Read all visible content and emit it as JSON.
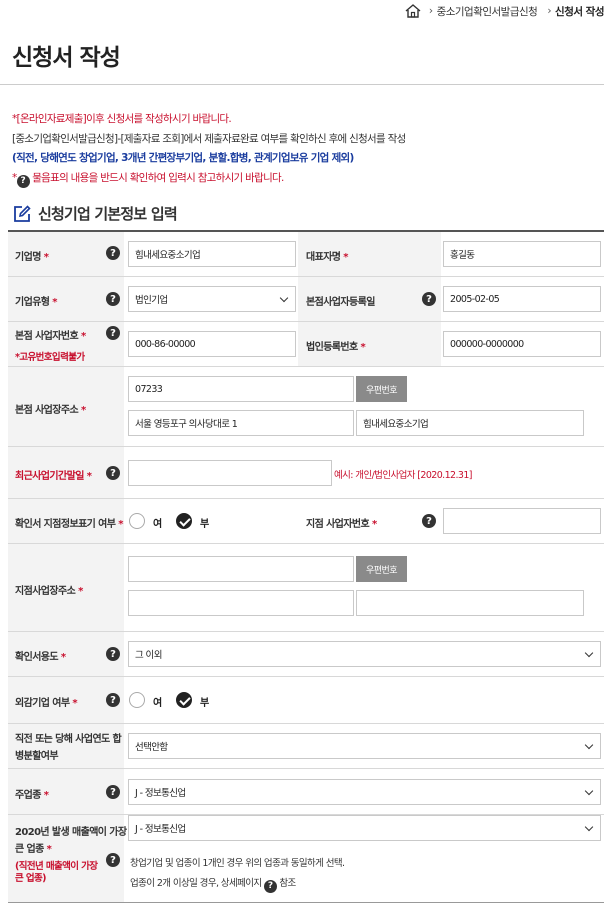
{
  "breadcrumb": {
    "item1": "중소기업확인서발급신청",
    "item2": "신청서 작성"
  },
  "page_title": "신청서 작성",
  "notice": {
    "line1": "*[온라인자료제출]이후 신청서를 작성하시기 바랍니다.",
    "line2": "[중소기업확인서발급신청]-[제출자료 조회]에서 제출자료완료 여부를 확인하신 후에 신청서를 작성",
    "line3": "(직전, 당해연도 창업기업, 3개년 간편장부기업, 분할.합병, 관계기업보유 기업 제외)",
    "line4_pre": "*",
    "line4": "물음표의 내용을 반드시 확인하여 입력시 참고하시기 바랍니다."
  },
  "section_title": "신청기업 기본정보 입력",
  "help_glyph": "?",
  "req_mark": "*",
  "form": {
    "company_name_label": "기업명",
    "company_name_value": "힘내세요중소기업",
    "rep_name_label": "대표자명",
    "rep_name_value": "홍길동",
    "company_type_label": "기업유형",
    "company_type_value": "법인기업",
    "hq_reg_date_label": "본점사업자등록일",
    "hq_reg_date_value": "2005-02-05",
    "hq_biz_no_label": "본점 사업자번호",
    "hq_biz_no_note": "*고유번호입력불가",
    "hq_biz_no_value": "000-86-00000",
    "corp_reg_no_label": "법인등록번호",
    "corp_reg_no_value": "000000-0000000",
    "hq_address_label": "본점 사업장주소",
    "hq_zip_value": "07233",
    "zip_button": "우편번호",
    "hq_addr1_value": "서울 영등포구 의사당대로 1",
    "hq_addr2_value": "힘내세요중소기업",
    "fiscal_end_label": "최근사업기간말일",
    "fiscal_end_value": "",
    "fiscal_end_example": "예시: 개인/법인사업자 [2020.12.31]",
    "branch_display_label": "확인서 지점정보표기 여부",
    "radio_yes": "여",
    "radio_no": "부",
    "branch_biz_no_label": "지점 사업자번호",
    "branch_biz_no_value": "",
    "branch_address_label": "지점사업장주소",
    "purpose_label": "확인서용도",
    "purpose_value": "그 이외",
    "foreign_label": "외감기업 여부",
    "split_merge_label_1": "직전 또는 당해 사업연도 합",
    "split_merge_label_2": "병분할여부",
    "split_merge_value": "선택안함",
    "main_industry_label": "주업종",
    "main_industry_value": "J - 정보통신업",
    "top_sales_label_1": "2020년 발생 매출액이 가장",
    "top_sales_label_2": "큰 업종",
    "top_sales_sub_1": "(직전년 매출액이 가장",
    "top_sales_sub_2": "큰 업종)",
    "top_sales_value": "J - 정보통신업",
    "top_sales_note1": "창업기업 및 업종이 1개인 경우 위의 업종과 동일하게 선택.",
    "top_sales_note2_a": "업종이 2개 이상일 경우, 상세페이지",
    "top_sales_note2_b": "참조"
  }
}
